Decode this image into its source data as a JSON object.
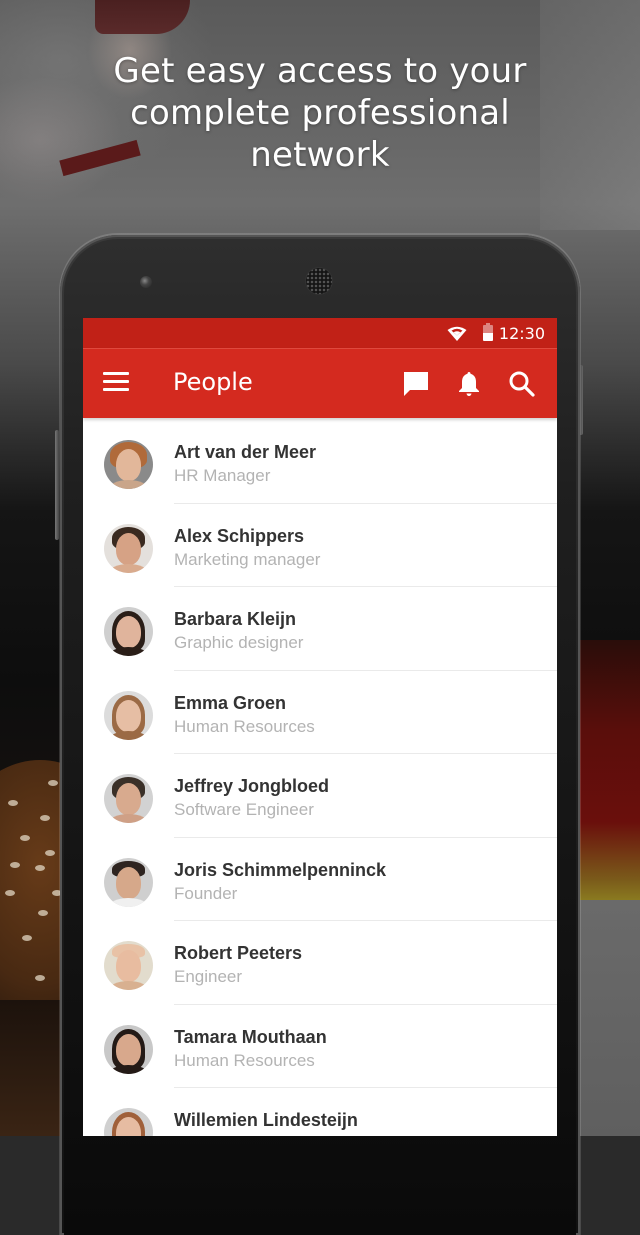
{
  "headline": {
    "lines": [
      "Get easy access to your",
      "complete professional",
      "network"
    ]
  },
  "status_bar": {
    "time": "12:30",
    "icons": [
      "wifi-icon",
      "battery-icon"
    ]
  },
  "toolbar": {
    "title": "People",
    "menu_icon": "hamburger-menu-icon",
    "actions": [
      {
        "name": "messages",
        "icon": "chat-bubble-icon"
      },
      {
        "name": "notifications",
        "icon": "bell-icon"
      },
      {
        "name": "search",
        "icon": "search-icon"
      }
    ]
  },
  "colors": {
    "status_bar": "#c12117",
    "toolbar": "#d42a1f",
    "name_text": "#333333",
    "role_text": "#b3b3b3",
    "divider": "#eaeaea"
  },
  "people": [
    {
      "name": "Art van der Meer",
      "role": "HR Manager"
    },
    {
      "name": "Alex Schippers",
      "role": "Marketing manager"
    },
    {
      "name": "Barbara Kleijn",
      "role": "Graphic designer"
    },
    {
      "name": "Emma Groen",
      "role": "Human Resources"
    },
    {
      "name": "Jeffrey Jongbloed",
      "role": "Software Engineer"
    },
    {
      "name": "Joris Schimmelpenninck",
      "role": "Founder"
    },
    {
      "name": "Robert Peeters",
      "role": "Engineer"
    },
    {
      "name": "Tamara Mouthaan",
      "role": "Human Resources"
    },
    {
      "name": "Willemien Lindesteijn",
      "role": ""
    }
  ]
}
